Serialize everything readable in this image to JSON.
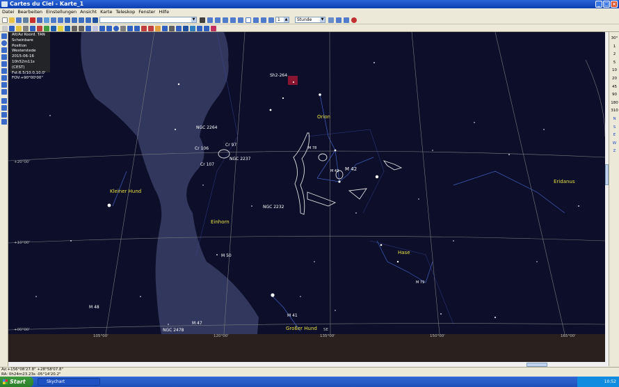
{
  "window": {
    "title": "Cartes du Ciel - Karte_1"
  },
  "menu": [
    "Datei",
    "Bearbeiten",
    "Einstellungen",
    "Ansicht",
    "Karte",
    "Teleskop",
    "Fenster",
    "Hilfe"
  ],
  "toolbar": {
    "step_value": "1",
    "step_unit": "Stunde"
  },
  "info_panel": [
    "Alt/Az Koord. TAN",
    "Scheinbare Position",
    "Westerstede",
    "2015-06-16",
    "10h52m11s (CEST)",
    "Fst:6.5/10.0,10.0'",
    "FOV:+90°00'00\""
  ],
  "fov_list": [
    "30°",
    "1",
    "2",
    "5",
    "10",
    "20",
    "45",
    "90",
    "180",
    "310",
    "N",
    "S",
    "E",
    "W",
    "Z"
  ],
  "chart_labels": {
    "constellations": {
      "orion": "Orion",
      "kleiner_hund": "Kleiner Hund",
      "einhorn": "Einhorn",
      "eridanus": "Eridanus",
      "hase": "Hase",
      "grosser_hund": "Großer Hund"
    },
    "objects": {
      "sh2": "Sh2-264",
      "ngc2264": "NGC 2264",
      "cr106": "Cr 106",
      "cr97": "Cr 97",
      "ngc2237": "NGC 2237",
      "cr107": "Cr 107",
      "m78": "M 78",
      "m43": "M 43",
      "m42": "M 42",
      "ngc2232": "NGC 2232",
      "m50": "M 50",
      "m48": "M 48",
      "m47": "M 47",
      "ngc2478": "NGC 2478",
      "m41": "M 41",
      "m79": "M 79"
    },
    "grid": {
      "dec20": "+20°00'",
      "dec10": "+10°00'",
      "dec0": "+00°00'",
      "ra105": "105°00'",
      "ra120": "120°00'",
      "ra135": "135°00'",
      "ra150": "150°00'",
      "ra165": "165°00'",
      "se": "SE"
    }
  },
  "status": {
    "line1": "Az:+156°08'27.8\" +28°58'07.8\"",
    "line2": "RA: 0h24m23.23s -05°14'20.2\""
  },
  "taskbar": {
    "start": "Start",
    "task": "Skychart",
    "clock": "10:52"
  }
}
